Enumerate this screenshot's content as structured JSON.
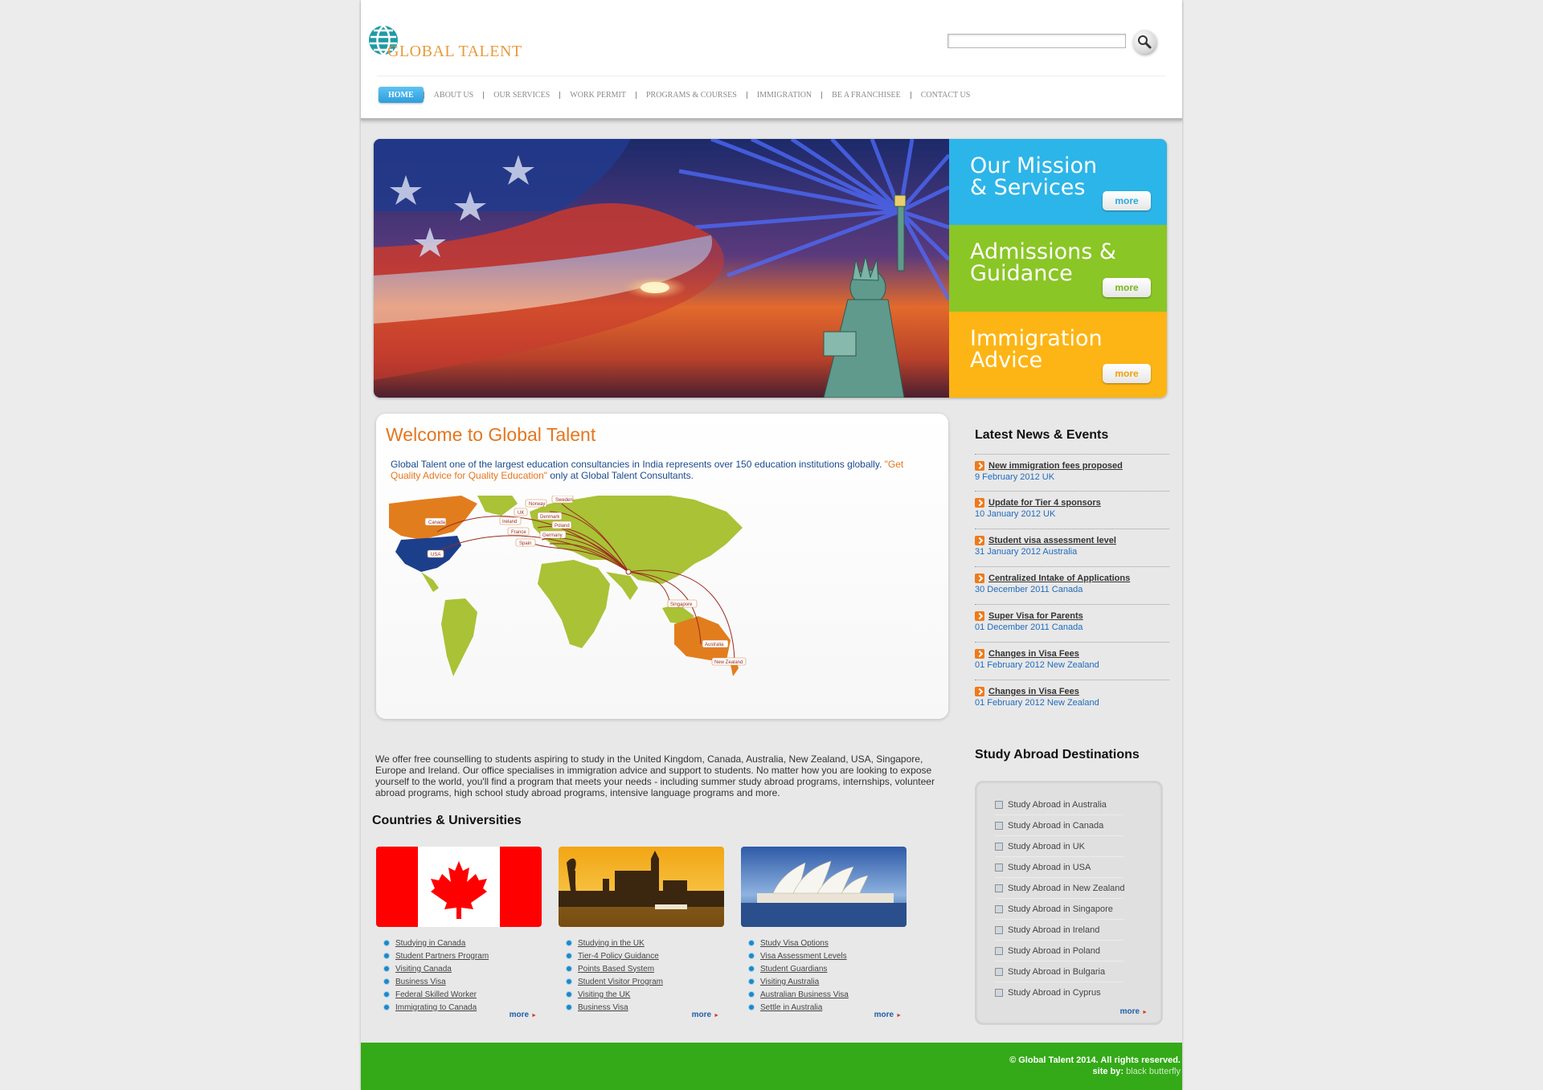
{
  "brand": {
    "name": "GLOBAL TALENT",
    "accent": "#e89b3c",
    "globe_color": "#1f9aa6"
  },
  "search": {
    "value": "",
    "placeholder": ""
  },
  "nav": {
    "items": [
      {
        "label": "HOME",
        "active": true
      },
      {
        "label": "ABOUT US"
      },
      {
        "label": "OUR SERVICES"
      },
      {
        "label": "WORK PERMIT"
      },
      {
        "label": "PROGRAMS & COURSES"
      },
      {
        "label": "IMMIGRATION"
      },
      {
        "label": "BE A FRANCHISEE"
      },
      {
        "label": "CONTACT US"
      }
    ]
  },
  "promos": [
    {
      "title": "Our Mission\n & Services",
      "more": "more",
      "color": "#2cb5e8",
      "more_color": "#2ba7e0"
    },
    {
      "title": "Admissions &\n Guidance",
      "more": "more",
      "color": "#8ac626",
      "more_color": "#79b51f"
    },
    {
      "title": "Immigration\n Advice",
      "more": "more",
      "color": "#fdb515",
      "more_color": "#f0a00c"
    }
  ],
  "welcome": {
    "title": "Welcome to Global Talent",
    "intro_part1": "Global Talent one of the largest education consultancies in India represents over 150 education institutions globally. ",
    "intro_highlight": "\"Get Quality Advice for Quality Education\"",
    "intro_part2": " only at Global Talent Consultants.",
    "map_labels": [
      "Canada",
      "USA",
      "Norway",
      "Sweden",
      "UK",
      "Denmark",
      "Ireland",
      "Poland",
      "France",
      "Germany",
      "Spain",
      "Singapore",
      "Australia",
      "New Zealand"
    ]
  },
  "counselling_text": "We offer free counselling to students aspiring to study in the United Kingdom, Canada, Australia, New Zealand, USA, Singapore, Europe and Ireland. Our office specialises in immigration advice and support to students. No matter how you are looking to expose yourself to the world, you'll find a program that meets your needs - including summer study abroad programs, internships, volunteer abroad programs, high school study abroad programs, intensive language programs and more.",
  "countries": {
    "title": "Countries & Universities",
    "cards": [
      {
        "image": "canada-flag",
        "links": [
          "Studying in Canada",
          "Student Partners Program",
          "Visiting Canada",
          "Business Visa",
          "Federal Skilled Worker",
          "Immigrating to Canada"
        ],
        "more": "more"
      },
      {
        "image": "london-skyline",
        "links": [
          "Studying in the UK",
          "Tier-4 Policy Guidance",
          "Points Based System",
          "Student Visitor Program",
          "Visiting the UK",
          "Business Visa"
        ],
        "more": "more"
      },
      {
        "image": "sydney-opera-house",
        "links": [
          "Study Visa Options",
          "Visa Assessment Levels",
          "Student Guardians",
          "Visiting Australia",
          "Australian Business Visa",
          "Settle in Australia"
        ],
        "more": "more"
      }
    ]
  },
  "news": {
    "title": "Latest News & Events",
    "items": [
      {
        "title": "New immigration fees proposed",
        "meta": "9 February 2012 UK"
      },
      {
        "title": "Update for Tier 4 sponsors",
        "meta": "10 January 2012 UK"
      },
      {
        "title": "Student visa assessment level",
        "meta": "31 January 2012 Australia"
      },
      {
        "title": "Centralized Intake of Applications",
        "meta": "30 December 2011 Canada"
      },
      {
        "title": "Super Visa for Parents",
        "meta": "01 December 2011 Canada"
      },
      {
        "title": "Changes in Visa Fees",
        "meta": "01 February 2012 New Zealand"
      },
      {
        "title": "Changes in Visa Fees",
        "meta": "01 February 2012 New Zealand"
      }
    ]
  },
  "destinations": {
    "title": "Study Abroad Destinations",
    "items": [
      "Study Abroad in Australia",
      "Study Abroad in Canada",
      "Study Abroad in UK",
      "Study Abroad in USA",
      "Study Abroad in New Zealand",
      "Study Abroad in Singapore",
      "Study Abroad in Ireland",
      "Study Abroad in Poland",
      "Study Abroad in Bulgaria",
      "Study Abroad in Cyprus"
    ],
    "more": "more"
  },
  "footer": {
    "copyright": "© Global Talent 2014. All rights reserved.",
    "credit_prefix": "site by: ",
    "credit_name": "black butterfly",
    "color": "#34aa18"
  }
}
